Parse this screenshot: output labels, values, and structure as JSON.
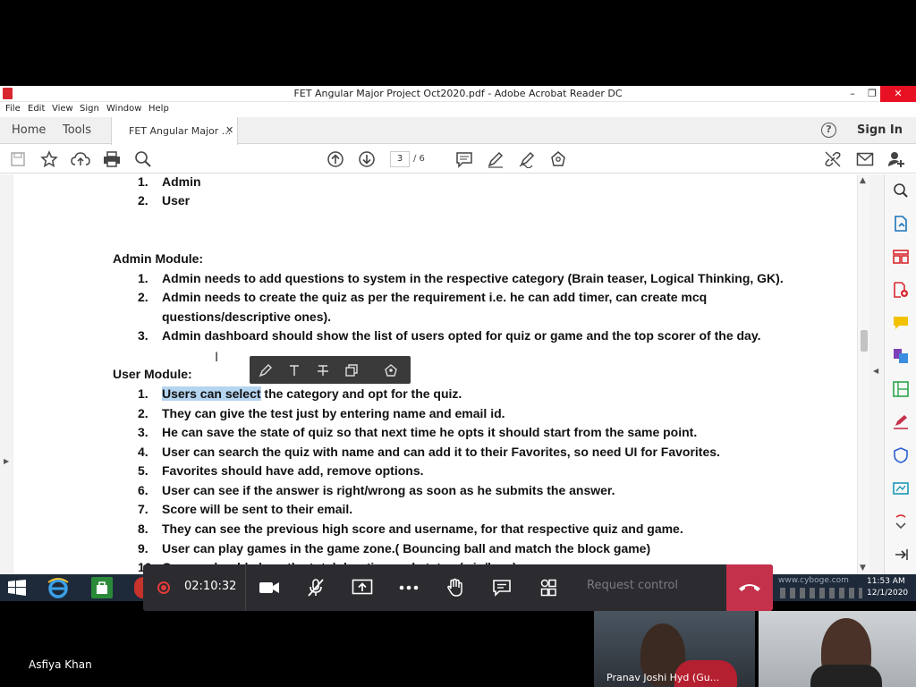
{
  "window": {
    "title": "FET Angular Major Project Oct2020.pdf - Adobe Acrobat Reader DC",
    "minimize": "–",
    "restore": "❐",
    "close": "✕"
  },
  "menu": [
    "File",
    "Edit",
    "View",
    "Sign",
    "Window",
    "Help"
  ],
  "tabs": {
    "home": "Home",
    "tools": "Tools",
    "document": "FET Angular Major ...",
    "close": "✕",
    "help": "?",
    "sign_in": "Sign In"
  },
  "toolbar": {
    "page_current": "3",
    "page_total": "/ 6"
  },
  "document": {
    "roles": [
      {
        "num": "1.",
        "text": "Admin"
      },
      {
        "num": "2.",
        "text": "User"
      }
    ],
    "admin_heading": "Admin Module:",
    "admin_items": [
      {
        "num": "1.",
        "text": "Admin needs to add questions to system in the respective category (Brain teaser, Logical Thinking, GK)."
      },
      {
        "num": "2.",
        "text": "Admin needs to create the quiz as per the requirement i.e. he can add timer, can create mcq"
      },
      {
        "num": "",
        "text": "questions/descriptive ones)."
      },
      {
        "num": "3.",
        "text": "Admin dashboard should show the list of users opted for quiz or game and the top scorer of the day."
      }
    ],
    "user_heading": "User Module:",
    "user_item1_selected": "Users can select",
    "user_item1_rest": " the category and opt for the quiz.",
    "user_items": [
      {
        "num": "2.",
        "text": "They can give the test just by entering name and email id."
      },
      {
        "num": "3.",
        "text": "He can save the state of quiz so that next time he opts it should start from the same point."
      },
      {
        "num": "4.",
        "text": "User can search the quiz with name and can add it to their Favorites, so need UI for Favorites."
      },
      {
        "num": "5.",
        "text": "Favorites should have add, remove options."
      },
      {
        "num": "6.",
        "text": "User can see if the answer is right/wrong as soon as he submits the answer."
      },
      {
        "num": "7.",
        "text": "Score will be sent to their email."
      },
      {
        "num": "8.",
        "text": "They can see the previous high score and username, for that respective quiz and game."
      },
      {
        "num": "9.",
        "text": "User can play games in the game zone.( Bouncing ball and match the block game)"
      },
      {
        "num": "10.",
        "text": "Games should show the total duration and status (win/lose)."
      }
    ]
  },
  "meeting": {
    "timer": "02:10:32",
    "request_control": "Request control",
    "presenter_name": "Asfiya Khan",
    "participant_label": "Pranav Joshi Hyd (Gu..."
  },
  "taskbar": {
    "time": "11:53 AM",
    "date": "12/1/2020"
  },
  "colors": {
    "selection": "#b5d4f0",
    "hangup": "#c4314b",
    "record": "#e23b3b"
  }
}
